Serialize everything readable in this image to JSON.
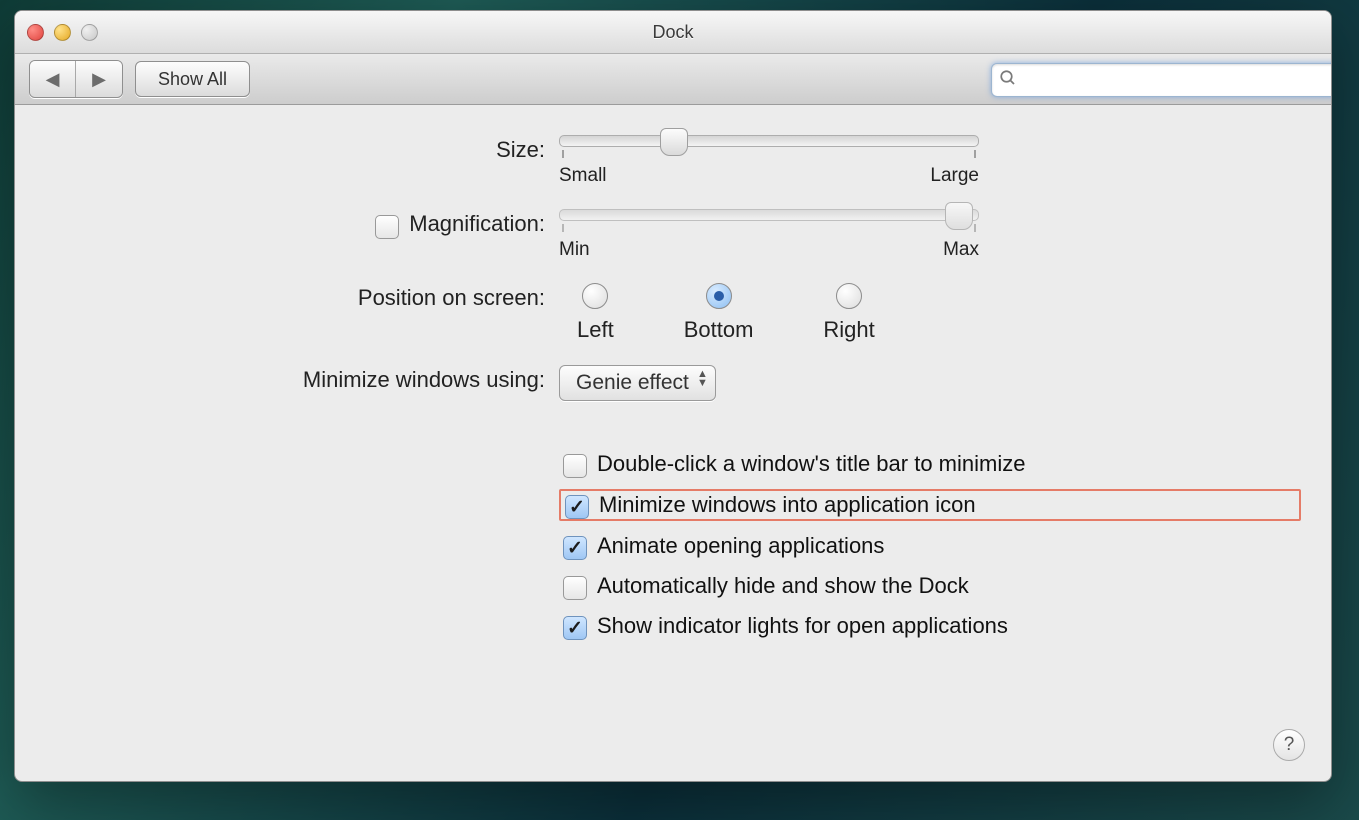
{
  "window": {
    "title": "Dock"
  },
  "toolbar": {
    "show_all": "Show All",
    "search_placeholder": ""
  },
  "size": {
    "label": "Size:",
    "min_label": "Small",
    "max_label": "Large",
    "value_percent": 24
  },
  "magnification": {
    "checkbox_label": "Magnification:",
    "checked": false,
    "min_label": "Min",
    "max_label": "Max",
    "value_percent": 96
  },
  "position": {
    "label": "Position on screen:",
    "options": {
      "left": "Left",
      "bottom": "Bottom",
      "right": "Right"
    },
    "selected": "bottom"
  },
  "minimize_using": {
    "label": "Minimize windows using:",
    "value": "Genie effect"
  },
  "checks": {
    "doubleclick": {
      "label": "Double-click a window's title bar to minimize",
      "checked": false
    },
    "minimize_into_icon": {
      "label": "Minimize windows into application icon",
      "checked": true,
      "highlighted": true
    },
    "animate": {
      "label": "Animate opening applications",
      "checked": true
    },
    "autohide": {
      "label": "Automatically hide and show the Dock",
      "checked": false
    },
    "indicator": {
      "label": "Show indicator lights for open applications",
      "checked": true
    }
  },
  "help": "?"
}
